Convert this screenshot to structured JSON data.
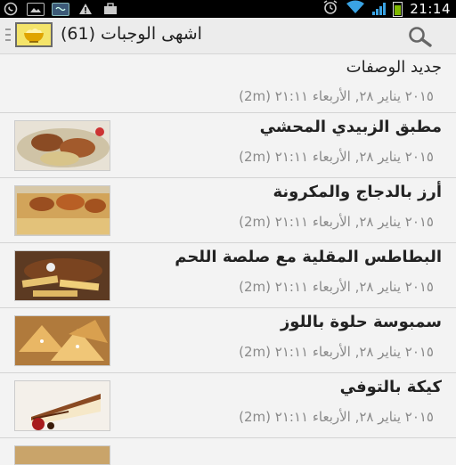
{
  "statusbar": {
    "time": "21:14",
    "icons": [
      "whatsapp-icon",
      "image-icon",
      "sim-icon",
      "warning-icon",
      "bag-icon",
      "alarm-icon",
      "wifi-icon",
      "signal-icon",
      "battery-icon"
    ]
  },
  "actionbar": {
    "title": "اشهى الوجبات (61)",
    "menu_icon": "menu-icon",
    "logo_icon": "food-bowl-icon",
    "search_icon": "search-icon"
  },
  "list": {
    "header": {
      "title": "جديد الوصفات",
      "meta": "٢٠١٥ يناير ٢٨, الأربعاء ٢١:١١ (2m)"
    },
    "items": [
      {
        "title": "مطبق الزبيدي المحشي",
        "meta": "٢٠١٥ يناير ٢٨, الأربعاء ٢١:١١ (2m)",
        "thumb_color": "#9b5a2e"
      },
      {
        "title": "أرز بالدجاج والمكرونة",
        "meta": "٢٠١٥ يناير ٢٨, الأربعاء ٢١:١١ (2m)",
        "thumb_color": "#c98a3e"
      },
      {
        "title": "البطاطس المقلية مع صلصة اللحم",
        "meta": "٢٠١٥ يناير ٢٨, الأربعاء ٢١:١١ (2m)",
        "thumb_color": "#b76a2a"
      },
      {
        "title": "سمبوسة حلوة باللوز",
        "meta": "٢٠١٥ يناير ٢٨, الأربعاء ٢١:١١ (2m)",
        "thumb_color": "#d89a4c"
      },
      {
        "title": "كيكة بالتوفي",
        "meta": "٢٠١٥ يناير ٢٨, الأربعاء ٢١:١١ (2m)",
        "thumb_color": "#e9d8b8"
      }
    ],
    "partial_item": {
      "title": "..."
    }
  }
}
